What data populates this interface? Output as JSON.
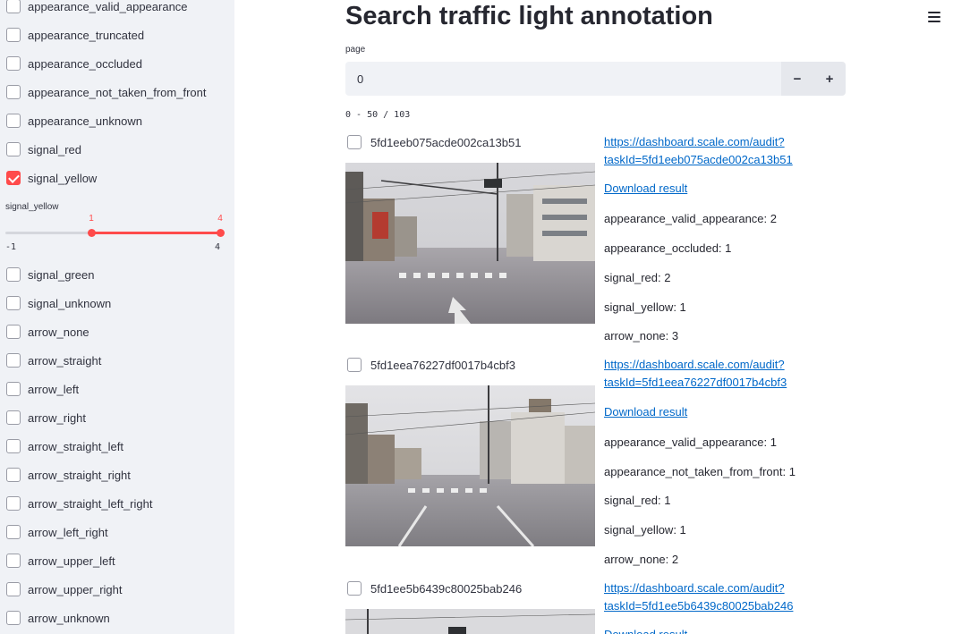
{
  "sidebar": {
    "checkboxes_top": [
      {
        "label": "appearance_valid_appearance",
        "checked": false
      },
      {
        "label": "appearance_truncated",
        "checked": false
      },
      {
        "label": "appearance_occluded",
        "checked": false
      },
      {
        "label": "appearance_not_taken_from_front",
        "checked": false
      },
      {
        "label": "appearance_unknown",
        "checked": false
      },
      {
        "label": "signal_red",
        "checked": false
      },
      {
        "label": "signal_yellow",
        "checked": true
      }
    ],
    "slider": {
      "title": "signal_yellow",
      "min": -1,
      "max": 4,
      "low": 1,
      "high": 4,
      "min_label": "-1",
      "max_label": "4",
      "low_label": "1",
      "high_label": "4"
    },
    "checkboxes_bottom": [
      {
        "label": "signal_green",
        "checked": false
      },
      {
        "label": "signal_unknown",
        "checked": false
      },
      {
        "label": "arrow_none",
        "checked": false
      },
      {
        "label": "arrow_straight",
        "checked": false
      },
      {
        "label": "arrow_left",
        "checked": false
      },
      {
        "label": "arrow_right",
        "checked": false
      },
      {
        "label": "arrow_straight_left",
        "checked": false
      },
      {
        "label": "arrow_straight_right",
        "checked": false
      },
      {
        "label": "arrow_straight_left_right",
        "checked": false
      },
      {
        "label": "arrow_left_right",
        "checked": false
      },
      {
        "label": "arrow_upper_left",
        "checked": false
      },
      {
        "label": "arrow_upper_right",
        "checked": false
      },
      {
        "label": "arrow_unknown",
        "checked": false
      }
    ]
  },
  "main": {
    "title": "Search traffic light annotation",
    "page_label": "page",
    "page_value": "0",
    "minus": "−",
    "plus": "+",
    "range_text": "0 - 50 / 103",
    "menu_icon": "hamburger-menu-icon",
    "items": [
      {
        "id": "5fd1eeb075acde002ca13b51",
        "link_line1": "https://dashboard.scale.com/audit?",
        "link_line2": "taskId=5fd1eeb075acde002ca13b51",
        "download": "Download result",
        "stats": [
          "appearance_valid_appearance: 2",
          "appearance_occluded: 1",
          "signal_red: 2",
          "signal_yellow: 1",
          "arrow_none: 3"
        ]
      },
      {
        "id": "5fd1eea76227df0017b4cbf3",
        "link_line1": "https://dashboard.scale.com/audit?",
        "link_line2": "taskId=5fd1eea76227df0017b4cbf3",
        "download": "Download result",
        "stats": [
          "appearance_valid_appearance: 1",
          "appearance_not_taken_from_front: 1",
          "signal_red: 1",
          "signal_yellow: 1",
          "arrow_none: 2"
        ]
      },
      {
        "id": "5fd1ee5b6439c80025bab246",
        "link_line1": "https://dashboard.scale.com/audit?",
        "link_line2": "taskId=5fd1ee5b6439c80025bab246",
        "download": "Download result",
        "stats": []
      }
    ]
  },
  "colors": {
    "accent": "#ff4b4b",
    "link": "#0068c9",
    "sidebar_bg": "#f0f2f6"
  }
}
